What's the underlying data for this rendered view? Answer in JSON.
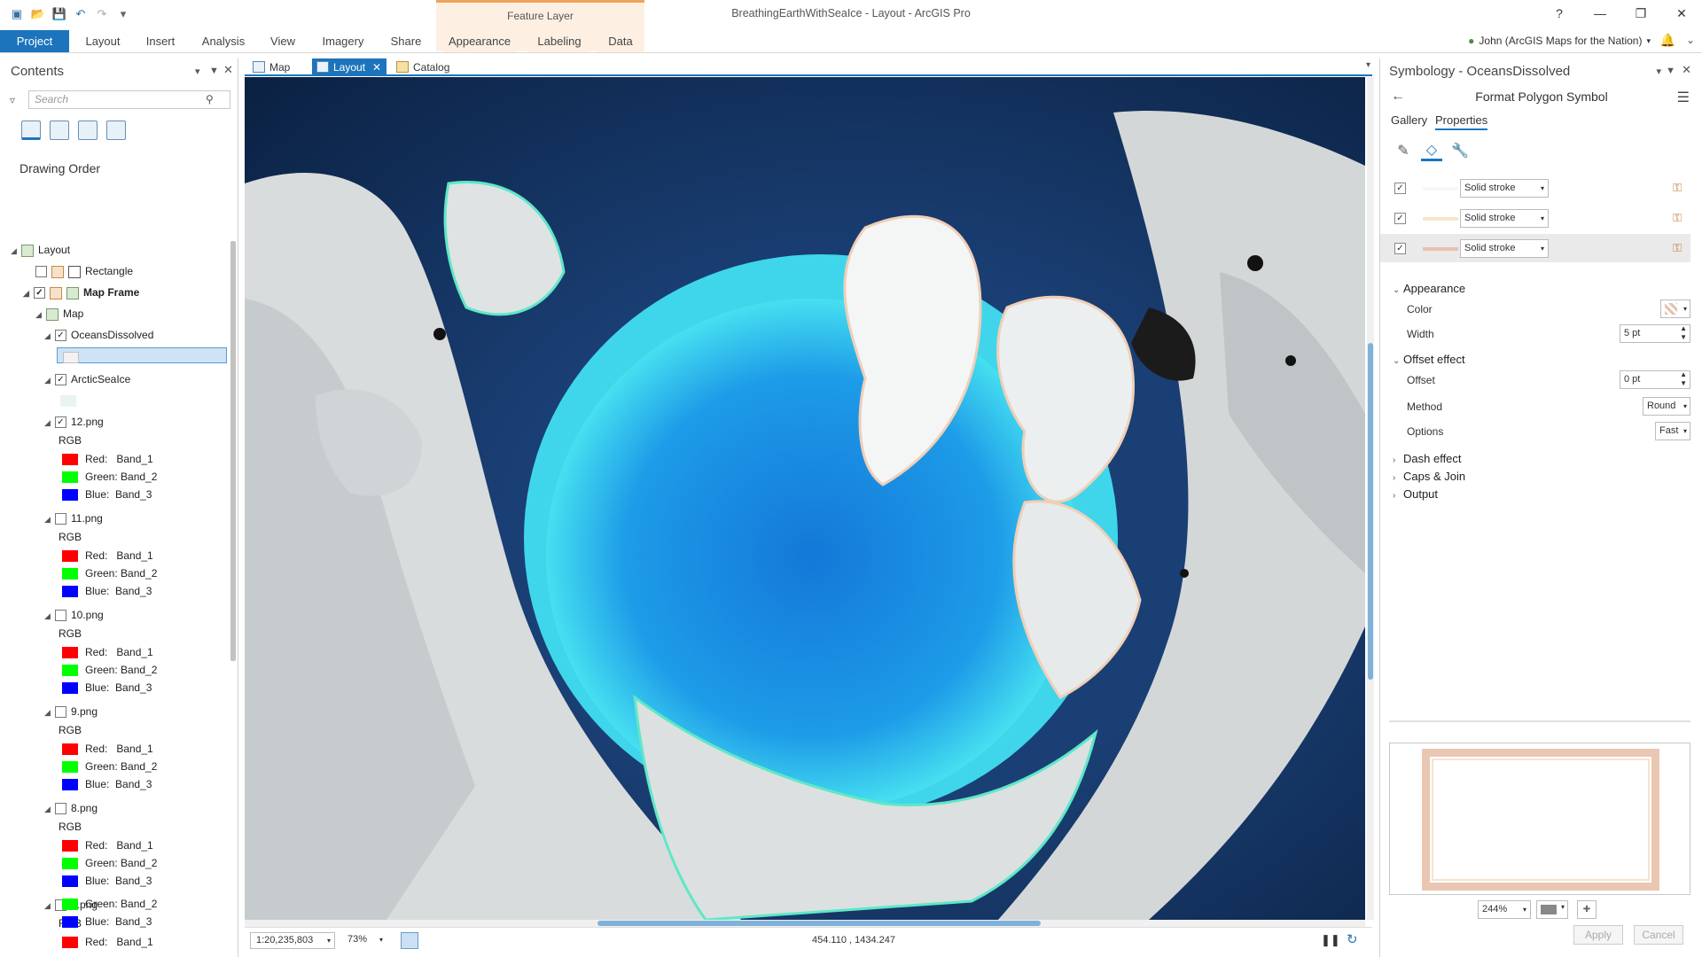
{
  "app": {
    "title": "BreathingEarthWithSeaIce - Layout - ArcGIS Pro",
    "contextual_tab": "Feature Layer",
    "help": "?",
    "user": "John (ArcGIS Maps for the Nation)"
  },
  "ribbon": {
    "tabs": [
      "Project",
      "Layout",
      "Insert",
      "Analysis",
      "View",
      "Imagery",
      "Share",
      "Appearance",
      "Labeling",
      "Data"
    ]
  },
  "contents": {
    "title": "Contents",
    "search_placeholder": "Search",
    "section": "Drawing Order",
    "layout": "Layout",
    "rectangle": "Rectangle",
    "map_frame": "Map Frame",
    "map": "Map",
    "oceans": "OceansDissolved",
    "seaice": "ArcticSeaIce",
    "rgb": "RGB",
    "band_red": "Red:   Band_1",
    "band_green": "Green: Band_2",
    "band_blue": "Blue:  Band_3",
    "rasters": [
      "12.png",
      "11.png",
      "10.png",
      "9.png",
      "8.png",
      "7.png"
    ]
  },
  "view_tabs": [
    "Map",
    "Layout",
    "Catalog"
  ],
  "status": {
    "scale": "1:20,235,803",
    "zoom": "73%",
    "coords": "454.110 , 1434.247"
  },
  "symbology": {
    "title": "Symbology - OceansDissolved",
    "subtitle": "Format Polygon Symbol",
    "tab_gallery": "Gallery",
    "tab_properties": "Properties",
    "layers": [
      "Solid stroke",
      "Solid stroke",
      "Solid stroke"
    ],
    "layer_colors": [
      "#ffffff",
      "#f8e6cc",
      "#e6c2b0"
    ],
    "appearance": "Appearance",
    "color_label": "Color",
    "width_label": "Width",
    "width_value": "5 pt",
    "offset_effect": "Offset effect",
    "offset_label": "Offset",
    "offset_value": "0 pt",
    "method_label": "Method",
    "method_value": "Round",
    "options_label": "Options",
    "options_value": "Fast",
    "dash_effect": "Dash effect",
    "caps_join": "Caps & Join",
    "output": "Output",
    "preview_zoom": "244%",
    "apply": "Apply",
    "cancel": "Cancel"
  },
  "colors": {
    "accent": "#1c75bc",
    "band_red": "#ff0000",
    "band_green": "#00ff00",
    "band_blue": "#0000ff"
  }
}
